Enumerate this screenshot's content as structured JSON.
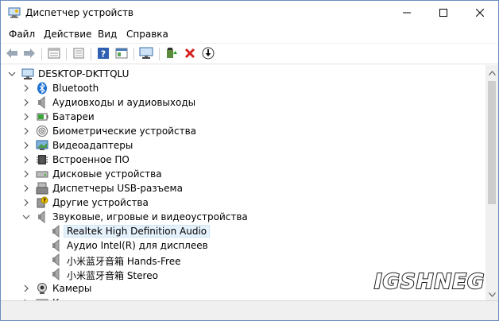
{
  "window": {
    "title": "Диспетчер устройств"
  },
  "menu": [
    "Файл",
    "Действие",
    "Вид",
    "Справка"
  ],
  "toolbar": {
    "buttons": [
      "back-icon",
      "forward-icon",
      "properties-icon",
      "tree-icon",
      "help-icon",
      "console-icon",
      "monitor-icon",
      "update-driver-icon",
      "uninstall-icon",
      "download-icon"
    ]
  },
  "tree": {
    "root": "DESKTOP-DKTTQLU",
    "categories": [
      {
        "label": "Bluetooth",
        "icon": "bluetooth-icon"
      },
      {
        "label": "Аудиовходы и аудиовыходы",
        "icon": "speaker-icon"
      },
      {
        "label": "Батареи",
        "icon": "battery-icon"
      },
      {
        "label": "Биометрические устройства",
        "icon": "fingerprint-icon"
      },
      {
        "label": "Видеоадаптеры",
        "icon": "display-adapter-icon"
      },
      {
        "label": "Встроенное ПО",
        "icon": "firmware-icon"
      },
      {
        "label": "Дисковые устройства",
        "icon": "disk-icon"
      },
      {
        "label": "Диспетчеры USB-разъема",
        "icon": "usb-icon"
      },
      {
        "label": "Другие устройства",
        "icon": "unknown-device-icon"
      },
      {
        "label": "Звуковые, игровые и видеоустройства",
        "icon": "speaker-icon"
      }
    ],
    "sound_children": [
      "Realtek High Definition Audio",
      "Аудио Intel(R) для дисплеев",
      "小米蓝牙音箱 Hands-Free",
      "小米蓝牙音箱 Stereo"
    ],
    "after": [
      {
        "label": "Камеры",
        "icon": "camera-icon"
      },
      {
        "label": "К",
        "icon": "keyboard-icon"
      }
    ]
  },
  "watermark": "IGSHNEG",
  "colors": {
    "selection": "#e5f1fb",
    "border": "#6b8cbf"
  }
}
